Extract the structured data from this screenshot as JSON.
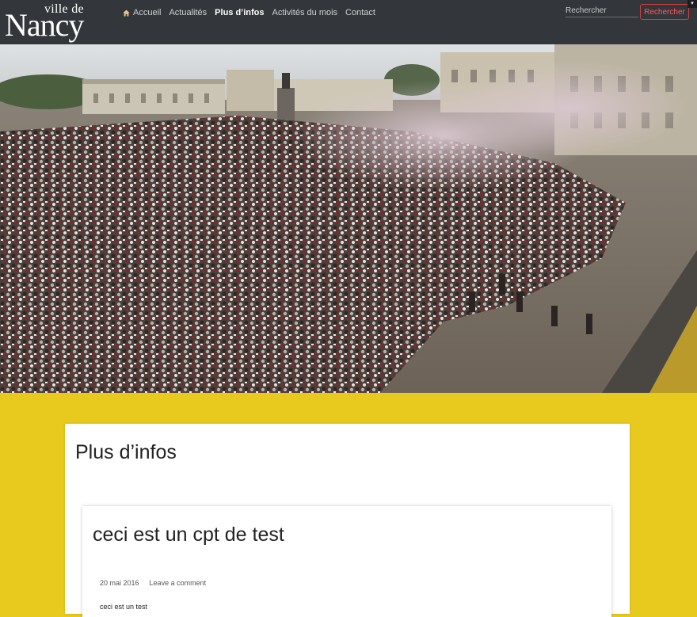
{
  "header": {
    "logo_small": "ville de",
    "logo_big": "Nancy",
    "nav": [
      {
        "label": "Accueil",
        "icon": "home-icon"
      },
      {
        "label": "Actualités"
      },
      {
        "label": "Plus d’infos",
        "active": true
      },
      {
        "label": "Activités du mois"
      },
      {
        "label": "Contact"
      }
    ],
    "search": {
      "placeholder": "Rechercher",
      "button_label": "Rechercher"
    }
  },
  "hero": {
    "alt": "Crowd in Place Stanislas"
  },
  "page": {
    "title": "Plus d’infos",
    "posts": [
      {
        "title": "ceci est un cpt de test",
        "date": "20 mai 2016",
        "comment_link": "Leave a comment",
        "excerpt": "ceci est un test"
      }
    ]
  },
  "colors": {
    "nav_bg": "#33373b",
    "page_bg": "#e8c91e",
    "accent": "#ff5a5a"
  }
}
